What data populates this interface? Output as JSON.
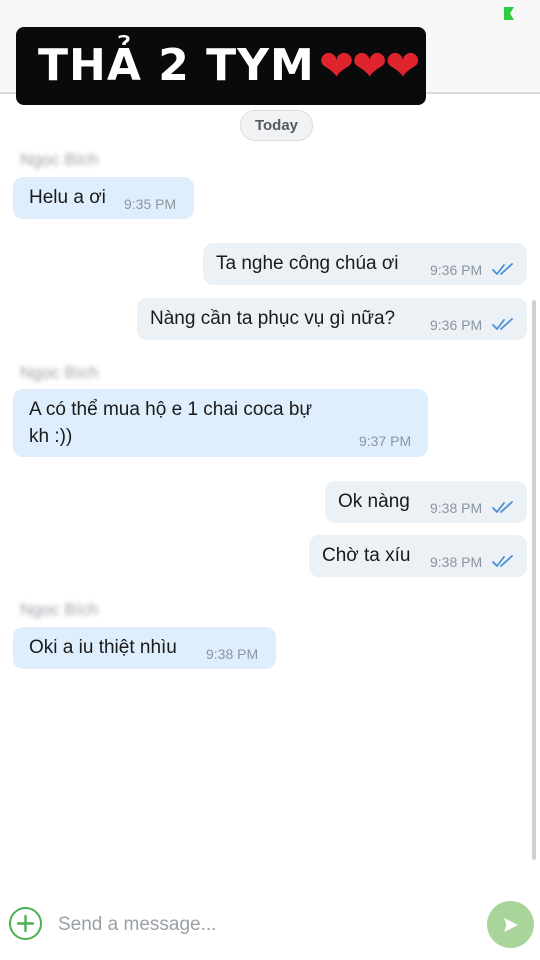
{
  "overlay": {
    "caption": "THẢ 2 TYM",
    "hearts": "❤❤❤"
  },
  "chat": {
    "date_separator": "Today",
    "sender_name": "Ngọc Bích",
    "messages": [
      {
        "direction": "incoming",
        "text": "Helu a ơi",
        "time": "9:35 PM"
      },
      {
        "direction": "outgoing",
        "text": "Ta nghe công chúa ơi",
        "time": "9:36 PM",
        "status": "read"
      },
      {
        "direction": "outgoing",
        "text": "Nàng cần ta phục vụ gì nữa?",
        "time": "9:36 PM",
        "status": "read"
      },
      {
        "direction": "incoming",
        "text_line1": "A có thể mua hộ e 1 chai coca bự",
        "text_line2": "kh :))",
        "time": "9:37 PM"
      },
      {
        "direction": "outgoing",
        "text": "Ok nàng",
        "time": "9:38 PM",
        "status": "read"
      },
      {
        "direction": "outgoing",
        "text": "Chờ ta xíu",
        "time": "9:38 PM",
        "status": "read"
      },
      {
        "direction": "incoming",
        "text": "Oki a iu thiệt nhìu",
        "time": "9:38 PM"
      }
    ]
  },
  "composer": {
    "placeholder": "Send a message...",
    "add_icon": "plus-circle-icon",
    "send_icon": "send-arrow-icon"
  },
  "colors": {
    "incoming_bubble": "#dfeefc",
    "outgoing_bubble": "#ecf1f6",
    "read_ticks": "#4a90d9",
    "accent_green": "#4caf50",
    "send_button": "#a9d59a",
    "heart": "#e0242e"
  }
}
